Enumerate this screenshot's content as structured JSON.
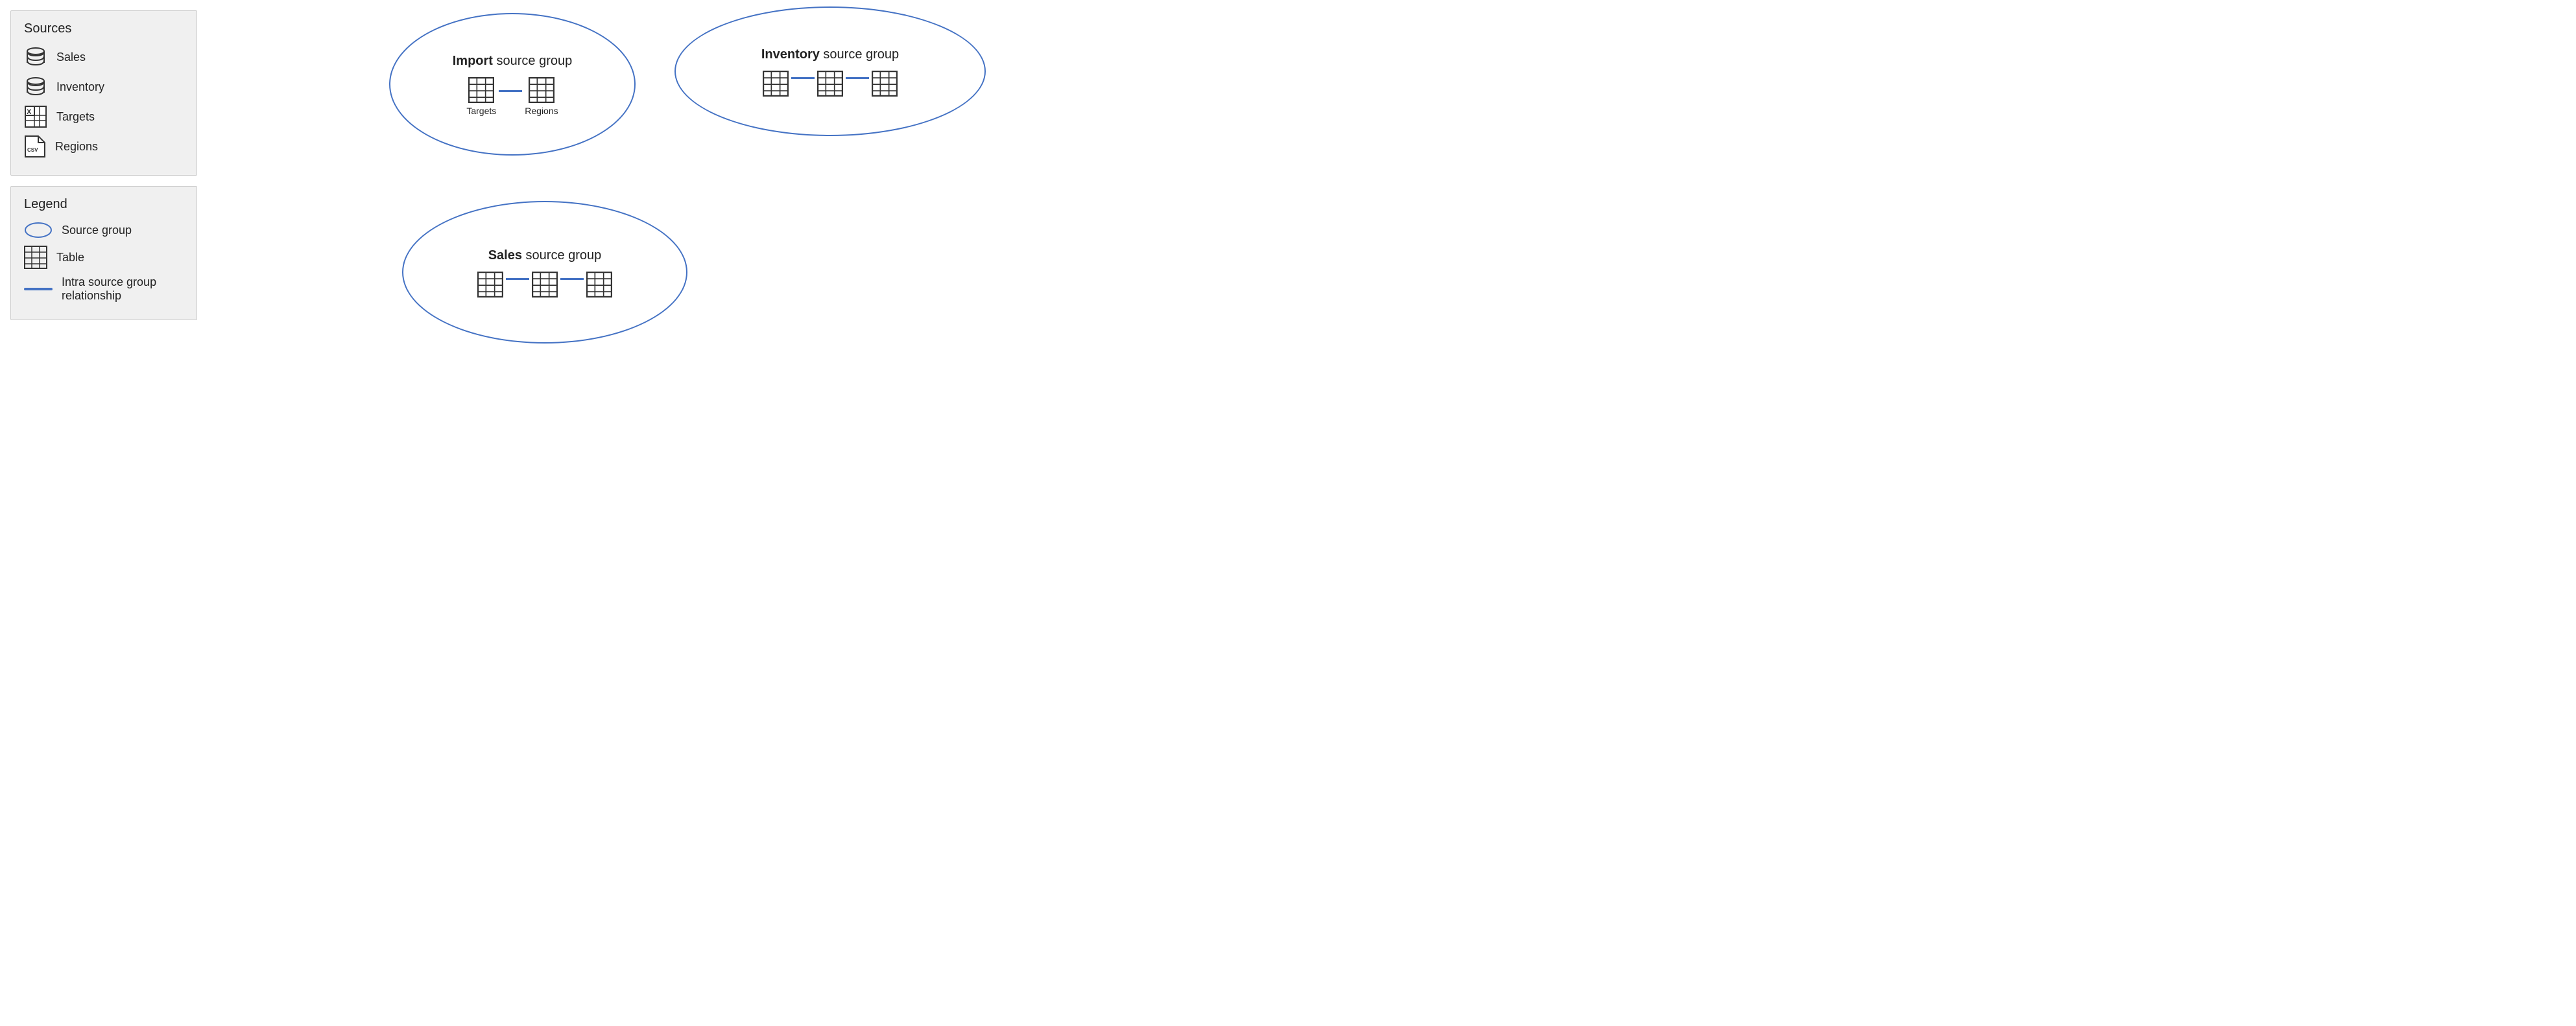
{
  "sources": {
    "title": "Sources",
    "items": [
      {
        "name": "Sales",
        "iconType": "db"
      },
      {
        "name": "Inventory",
        "iconType": "db"
      },
      {
        "name": "Targets",
        "iconType": "excel"
      },
      {
        "name": "Regions",
        "iconType": "csv"
      }
    ]
  },
  "legend": {
    "title": "Legend",
    "items": [
      {
        "label": "Source group",
        "iconType": "ellipse"
      },
      {
        "label": "Table",
        "iconType": "table"
      },
      {
        "label": "Intra source group relationship",
        "iconType": "line"
      }
    ]
  },
  "groups": [
    {
      "name": "import-group",
      "titleBold": "Import",
      "titleRest": " source group",
      "tables": [
        {
          "label": "Targets"
        },
        {
          "label": "Regions"
        }
      ]
    },
    {
      "name": "inventory-group",
      "titleBold": "Inventory",
      "titleRest": " source group",
      "tables": [
        {
          "label": ""
        },
        {
          "label": ""
        },
        {
          "label": ""
        }
      ]
    },
    {
      "name": "sales-group",
      "titleBold": "Sales",
      "titleRest": " source group",
      "tables": [
        {
          "label": ""
        },
        {
          "label": ""
        },
        {
          "label": ""
        }
      ]
    }
  ]
}
